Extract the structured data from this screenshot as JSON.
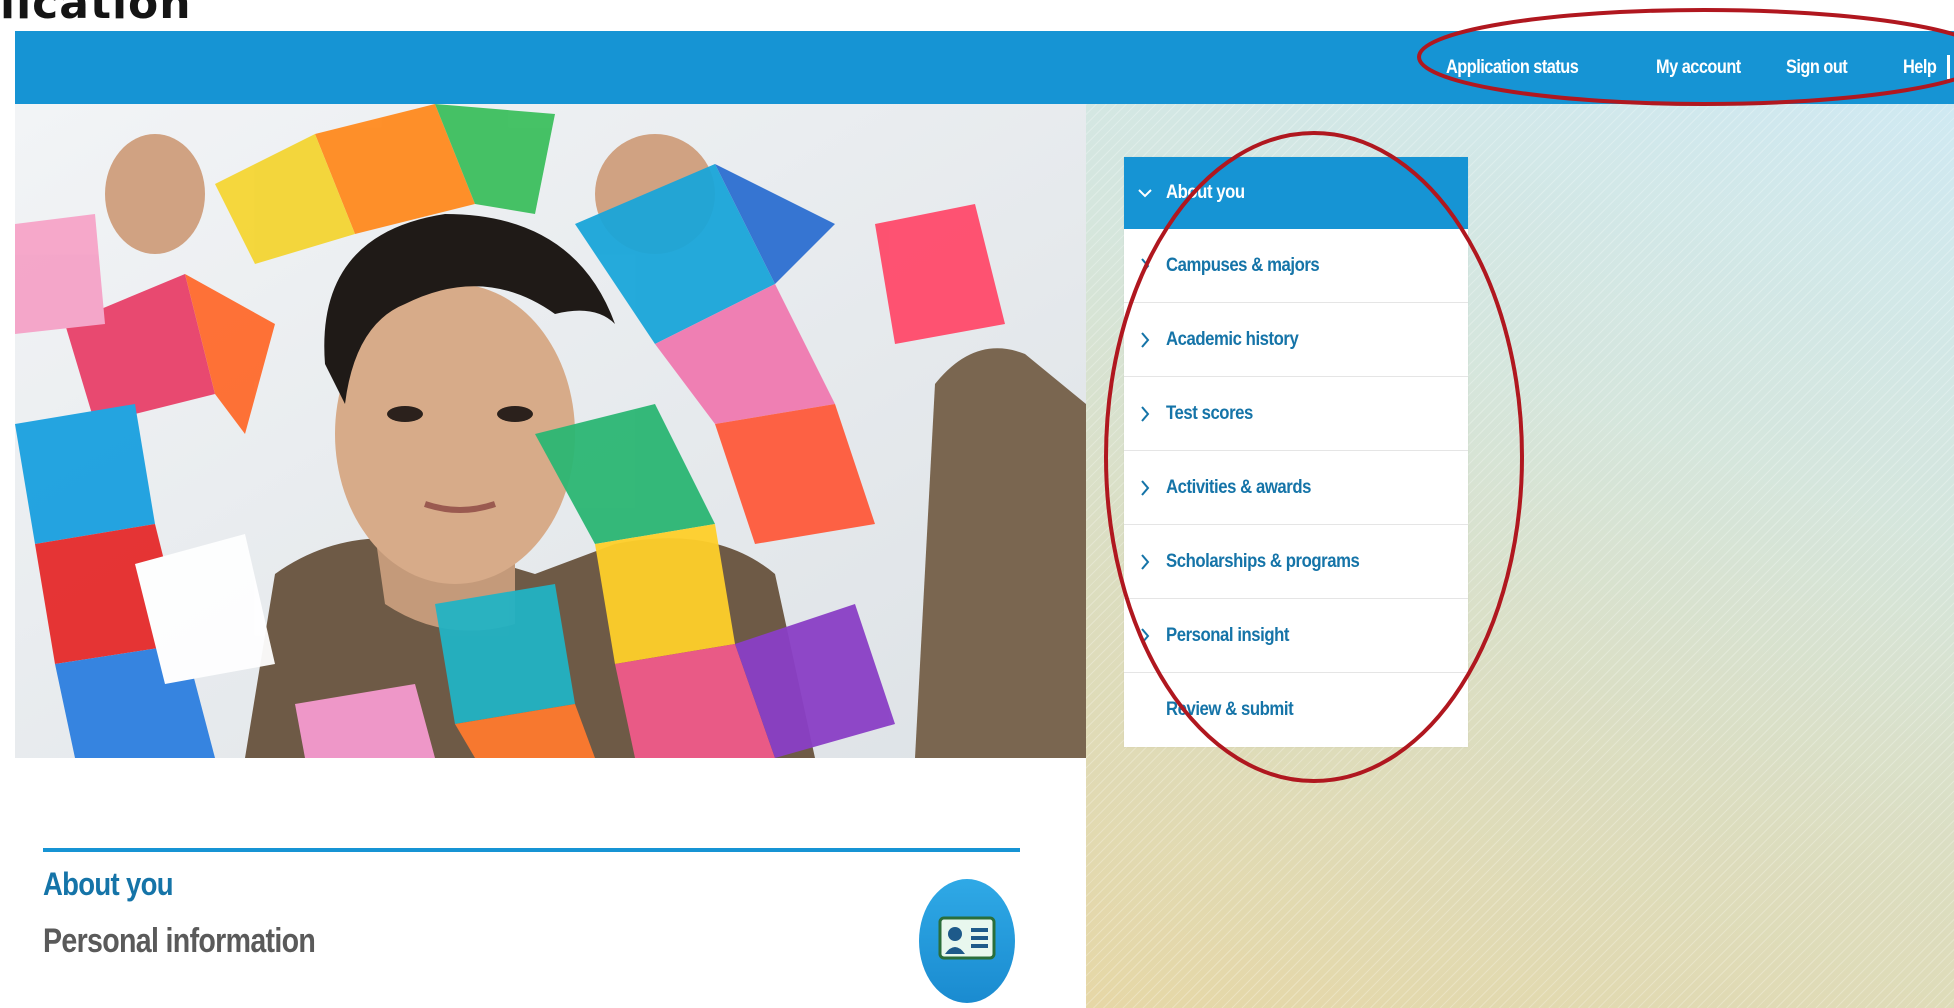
{
  "page": {
    "heading": "lication"
  },
  "nav": {
    "links": [
      "Application status",
      "My account",
      "Sign out",
      "Help"
    ]
  },
  "steps": {
    "active": "About you",
    "items": [
      {
        "label": "Campuses & majors",
        "icon": "chevron-right-icon"
      },
      {
        "label": "Academic history",
        "icon": "chevron-right-icon"
      },
      {
        "label": "Test scores",
        "icon": "chevron-right-icon"
      },
      {
        "label": "Activities & awards",
        "icon": "chevron-right-icon"
      },
      {
        "label": "Scholarships & programs",
        "icon": "chevron-right-icon"
      },
      {
        "label": "Personal insight",
        "icon": "chevron-right-icon"
      },
      {
        "label": "Review & submit",
        "icon": ""
      }
    ]
  },
  "section": {
    "title": "About you",
    "subtitle": "Personal information",
    "icon": "id-card-icon"
  },
  "colors": {
    "brand_blue": "#1694d4",
    "link_blue": "#1574a8",
    "annotation_red": "#b0171f"
  }
}
